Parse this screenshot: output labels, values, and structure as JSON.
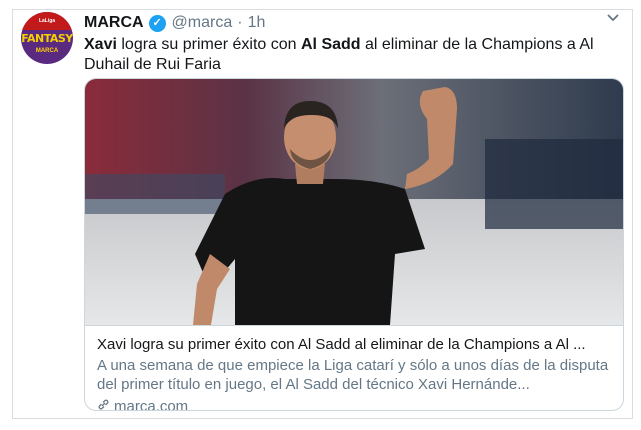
{
  "account": {
    "name": "MARCA",
    "handle": "@marca",
    "separator": "·",
    "time": "1h",
    "avatar_top_text": "LaLiga",
    "avatar_main_text": "FANTASY",
    "avatar_bottom_text": "MARCA"
  },
  "tweet": {
    "part1": "Xavi",
    "part2": " logra su primer éxito con ",
    "part3": "Al Sadd",
    "part4": " al eliminar de la Champions a Al Duhail de Rui Faria"
  },
  "card": {
    "title": "Xavi logra su primer éxito con Al Sadd al eliminar de la Champions a Al ...",
    "description": "A una semana de que empiece la Liga catarí y sólo a unos días de la disputa del primer título en juego, el Al Sadd del técnico Xavi Hernánde...",
    "domain": "marca.com"
  },
  "colors": {
    "verified": "#1da1f2",
    "text": "#14171a",
    "muted": "#657786"
  }
}
